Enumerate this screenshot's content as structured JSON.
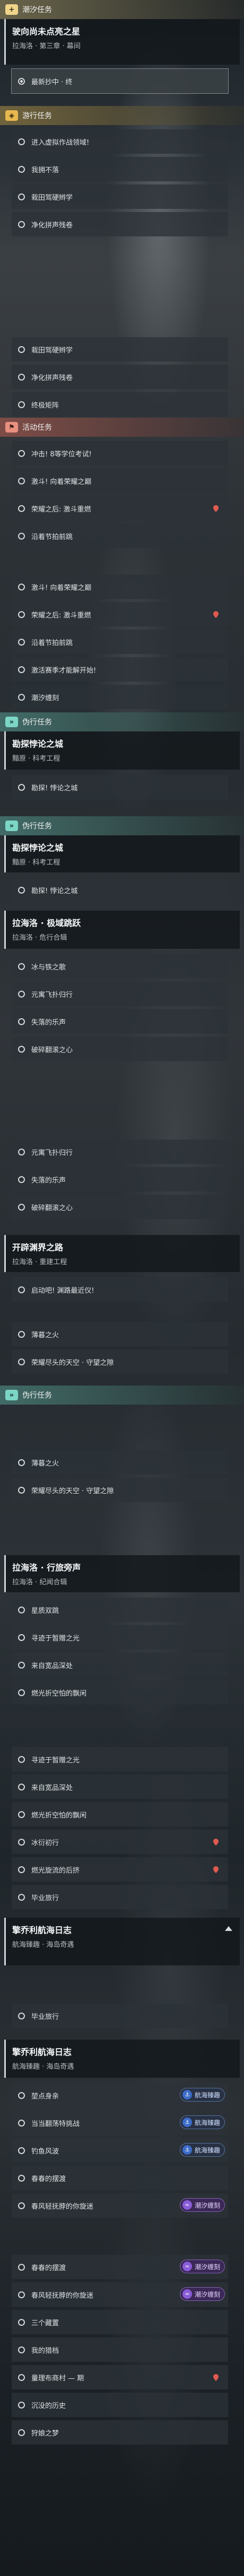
{
  "labels": {
    "daily": "潮汐任务",
    "trip": "游行任务",
    "act": "活动任务",
    "bo": "伪行任务",
    "bo2": "伪行任务",
    "bo3": "伪行任务"
  },
  "quests": {
    "q1": {
      "title": "驶向尚未点亮之星",
      "sub": "拉海洛 · 第三章 · 幕间"
    },
    "q2": {
      "title": "勘探悖论之城",
      "sub": "黯原 · 科考工程"
    },
    "q3": {
      "title": "勘探悖论之城",
      "sub": "黯原 · 科考工程"
    },
    "q4": {
      "title": "拉海洛 · 极域跳跃",
      "sub": "拉海洛 · 危行合辑"
    },
    "q5": {
      "title": "开辟渊界之路",
      "sub": "拉海洛 · 重建工程"
    },
    "q6": {
      "title": "拉海洛 · 行旅旁声",
      "sub": "拉海洛 · 纪闻合辑"
    },
    "q7": {
      "title": "擎乔利航海日志",
      "sub": "航海臻趣 · 海岛奇遇"
    },
    "q8": {
      "title": "擎乔利航海日志",
      "sub": "航海臻趣 · 海岛奇遇"
    }
  },
  "rows": {
    "r01": "最新抄中 · 终",
    "r02": "进入虚拟作战领域!",
    "r03": "我拥不落",
    "r04": "栽田驾硬辫学",
    "r05": "净化拼声残卷",
    "r06": "栽田驾硬辫学",
    "r07": "净化拼声残卷",
    "r08": "终极矩阵",
    "r09": "冲击! 8等学位考试!",
    "r10": "激斗! 向着荣耀之巅",
    "r11": "荣耀之后: 激斗重燃",
    "r12": "沿着节拍前跳",
    "r13": "激斗! 向着荣耀之巅",
    "r14": "荣耀之后: 激斗重燃",
    "r15": "沿着节拍前跳",
    "r16": "激活赛季才能解开始!",
    "r17": "潮汐缠刻",
    "r18": "勘探! 悖论之城",
    "r19": "勘探! 悖论之城",
    "r20": "冰与铁之歌",
    "r21": "元寓飞扑归行",
    "r22": "失落的乐声",
    "r23": "破碎翻滚之心",
    "r24": "元寓飞扑归行",
    "r25": "失落的乐声",
    "r26": "破碎翻滚之心",
    "r27": "启动吧! 渊路最近仪!",
    "r28": "薄暮之火",
    "r29": "荣耀尽头的天空 · 守望之隙",
    "r30": "薄暮之火",
    "r31": "荣耀尽头的天空 · 守望之隙",
    "r32": "星质双跳",
    "r33": "寻迹于暂赠之光",
    "r34": "来自宽品深处",
    "r35": "燃光折空怕的飘闲",
    "r36": "寻迹于暂赠之光",
    "r37": "来自宽品深处",
    "r38": "燃光折空怕的飘闲",
    "r39": "冰衍初行",
    "r40": "燃光旋流的后挤",
    "r41": "毕业旅行",
    "r42": "毕业旅行",
    "r43": "堃点身亲",
    "r44": "当当翻荡特挑战",
    "r45": "钓鱼风波",
    "r46": "春春的摆渡",
    "r47": "春风轻抚脖的你旋迷",
    "r48": "春春的摆渡",
    "r49": "春风轻抚脖的你旋迷",
    "r50": "三个藏置",
    "r51": "我的猎档",
    "r52": "量理布商村 — 期",
    "r53": "沉没的历史",
    "r54": "狩娘之梦"
  },
  "tags": {
    "hang": "航海臻趣",
    "chao": "潮汐缠刻"
  },
  "icons": {
    "daily": "plus-icon",
    "trip": "compass-icon",
    "act": "flag-icon",
    "bo": "chevron-right-icon",
    "pin": "location-pin-icon",
    "chevron": "chevron-up-icon"
  },
  "colors": {
    "daily": "#f0d48a",
    "trip": "#e8b850",
    "act": "#e89080",
    "bo": "#7cd6c6",
    "pin": "#e05a50"
  }
}
